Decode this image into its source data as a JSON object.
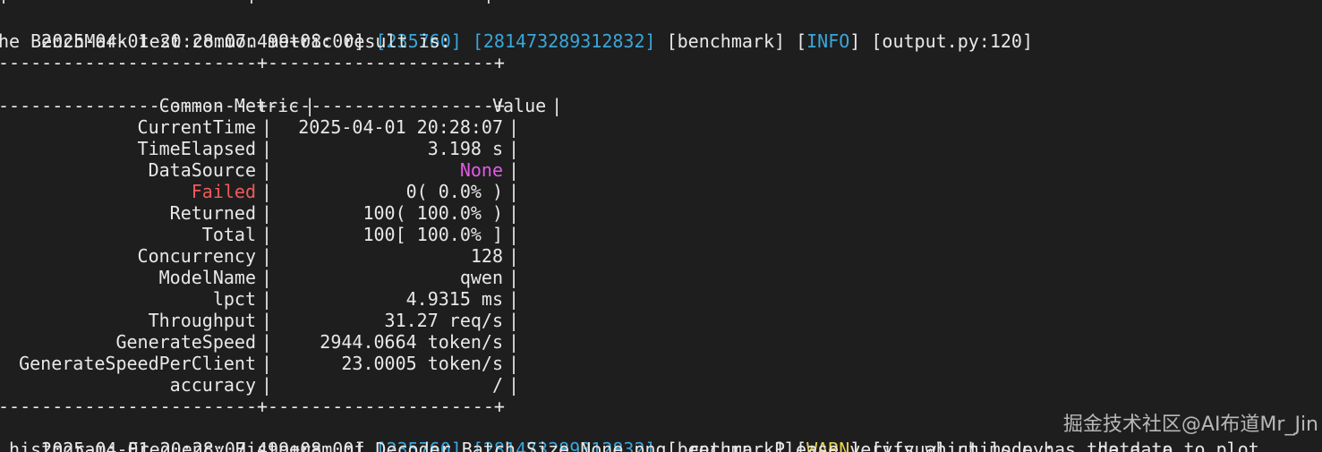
{
  "terminal": {
    "top_partial": "+----------------------+---------------------+",
    "log1": {
      "timestamp": "2025-04-01 20:28:07.499+08:00]",
      "pid": "[235760]",
      "tid": "[281473289312832]",
      "module": "[benchmark]",
      "level_open": "[",
      "level": "INFO",
      "level_close": "]",
      "source": "[output.py:120]"
    },
    "intro": "he BenchMark test common metric result is:",
    "border": "------------------------+---------------------+",
    "header": {
      "metric": "Common Metric",
      "value": "Value"
    },
    "rows": [
      {
        "name": "CurrentTime",
        "value": "2025-04-01 20:28:07",
        "name_style": "",
        "value_style": ""
      },
      {
        "name": "TimeElapsed",
        "value": "3.198 s",
        "name_style": "",
        "value_style": ""
      },
      {
        "name": "DataSource",
        "value": "None",
        "name_style": "",
        "value_style": "magenta"
      },
      {
        "name": "Failed",
        "value": "0( 0.0% )",
        "name_style": "red",
        "value_style": ""
      },
      {
        "name": "Returned",
        "value": "100( 100.0% )",
        "name_style": "",
        "value_style": ""
      },
      {
        "name": "Total",
        "value": "100[ 100.0% ]",
        "name_style": "",
        "value_style": ""
      },
      {
        "name": "Concurrency",
        "value": "128",
        "name_style": "",
        "value_style": ""
      },
      {
        "name": "ModelName",
        "value": "qwen",
        "name_style": "",
        "value_style": ""
      },
      {
        "name": "lpct",
        "value": "4.9315 ms",
        "name_style": "",
        "value_style": ""
      },
      {
        "name": "Throughput",
        "value": "31.27 req/s",
        "name_style": "",
        "value_style": ""
      },
      {
        "name": "GenerateSpeed",
        "value": "2944.0664 token/s",
        "name_style": "",
        "value_style": ""
      },
      {
        "name": "GenerateSpeedPerClient",
        "value": "23.0005 token/s",
        "name_style": "",
        "value_style": ""
      },
      {
        "name": "accuracy",
        "value": "/",
        "name_style": "",
        "value_style": ""
      }
    ],
    "log2": {
      "timestamp": "2025-04-01 20:28:07.499+08:00]",
      "pid": "[235760]",
      "tid": "[281473289312832]",
      "module": "[benchmark]",
      "level_open": "[",
      "level": "WARN",
      "level_close": "]",
      "source": "[visual_utils.py:",
      "tail": "    data to"
    },
    "last_line": " histogram: Frequency Histogram of Decoder Batch Size None.png, return. Please verify which mode has the data to plot",
    "watermark": "掘金技术社区@AI布道Mr_Jin",
    "colors": {
      "info": "#3aa6d9",
      "warn": "#e8d24c",
      "none": "#e05be6",
      "failed": "#f05a5a"
    }
  }
}
